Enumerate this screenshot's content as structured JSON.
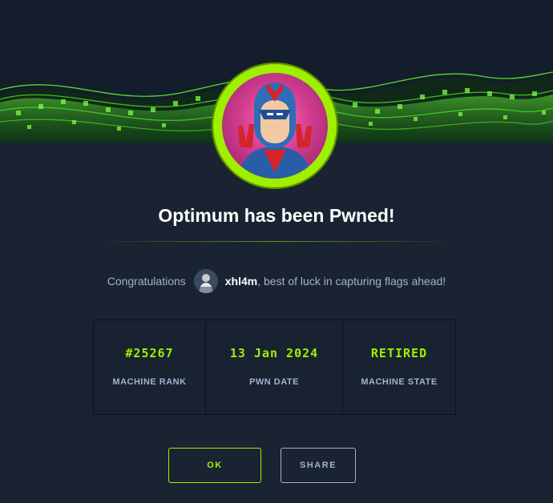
{
  "title": "Optimum has been Pwned!",
  "congrats": {
    "prefix": "Congratulations",
    "username": "xhl4m",
    "suffix": ", best of luck in capturing flags ahead!"
  },
  "stats": [
    {
      "value": "#25267",
      "label": "MACHINE RANK"
    },
    {
      "value": "13 Jan 2024",
      "label": "PWN DATE"
    },
    {
      "value": "RETIRED",
      "label": "MACHINE STATE"
    }
  ],
  "buttons": {
    "ok": "OK",
    "share": "SHARE"
  },
  "colors": {
    "background": "#1a2332",
    "accent": "#9fef00",
    "text_muted": "#a4b1cd",
    "text_bright": "#ffffff"
  },
  "icons": {
    "banner": "green-digital-wave-banner",
    "machine_badge": "optimum-machine-avatar",
    "user_avatar": "user-avatar"
  }
}
